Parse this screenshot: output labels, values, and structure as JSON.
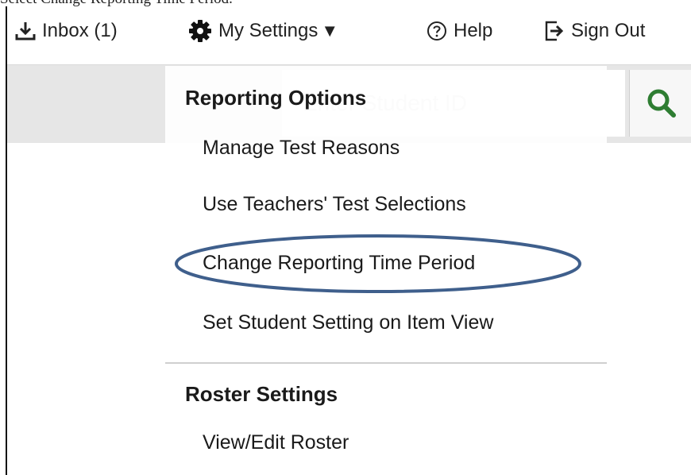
{
  "caption": "Select Change Reporting Time Period.",
  "toolbar": {
    "inbox_label": "Inbox (1)",
    "settings_label": "My Settings",
    "settings_caret": "▼",
    "help_label": "Help",
    "signout_label": "Sign Out"
  },
  "search": {
    "placeholder": "Enter Student ID"
  },
  "menu": {
    "reporting_title": "Reporting Options",
    "reporting_items": [
      "Manage Test Reasons",
      "Use Teachers' Test Selections",
      "Change Reporting Time Period",
      "Set Student Setting on Item View"
    ],
    "roster_title": "Roster Settings",
    "roster_items": [
      "View/Edit Roster"
    ]
  },
  "colors": {
    "highlight_ellipse": "#3f5f8c",
    "search_icon": "#2e7d32",
    "gray_strip": "#e6e6e6"
  }
}
